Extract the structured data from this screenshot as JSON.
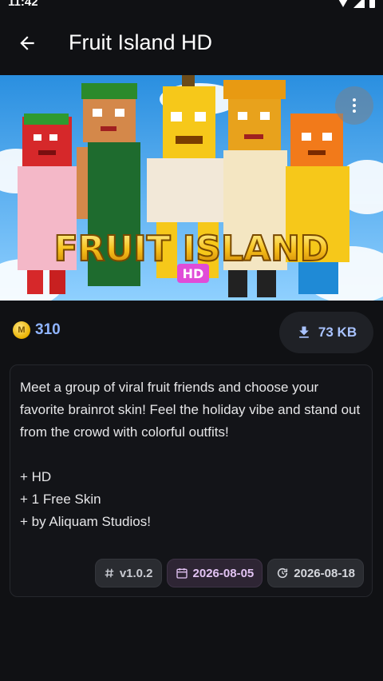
{
  "status_bar": {
    "time": "11:42"
  },
  "app_bar": {
    "title": "Fruit Island HD",
    "back_icon": "arrow-left-icon"
  },
  "banner": {
    "logo_text": "FRUIT ISLAND",
    "logo_sub": "HD",
    "menu_icon": "more-vert-icon"
  },
  "price": {
    "coin_symbol": "M",
    "value": "310"
  },
  "file_size": {
    "label": "73 KB",
    "icon": "download-icon"
  },
  "description": {
    "text": "Meet a group of viral fruit friends and choose your favorite brainrot skin! Feel the holiday vibe and stand out from the crowd with colorful outfits!\n\n+ HD\n+ 1 Free Skin\n+ by Aliquam Studios!"
  },
  "chips": {
    "version": "v1.0.2",
    "created": "2026-08-05",
    "updated": "2026-08-18"
  },
  "colors": {
    "background": "#101114",
    "accent_blue": "#8fb4ff",
    "chip_purple_bg": "#2e2534"
  }
}
